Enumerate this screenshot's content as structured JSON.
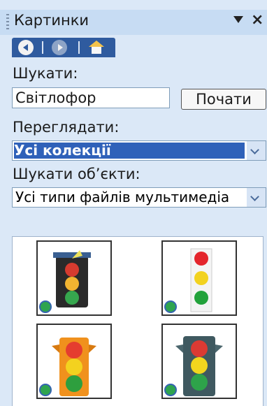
{
  "pane": {
    "title": "Картинки",
    "icons": [
      "pane-grip-icon",
      "dropdown-arrow-icon",
      "close-icon",
      "back-icon",
      "forward-icon",
      "home-icon"
    ]
  },
  "search": {
    "label": "Шукати:",
    "value": "Світлофор",
    "go_label": "Почати"
  },
  "browse": {
    "label": "Переглядати:",
    "selected": "Усі колекції"
  },
  "types": {
    "label": "Шукати об’єкти:",
    "selected": "Усі типи файлів мультимедіа"
  },
  "results": {
    "items": [
      "traffic-light-3d",
      "traffic-light-flat",
      "traffic-light-orange",
      "traffic-light-grey"
    ]
  },
  "colors": {
    "accent": "#2f61b9",
    "pane_bg": "#dbe8f7",
    "titlebar": "#c7dcf3"
  }
}
